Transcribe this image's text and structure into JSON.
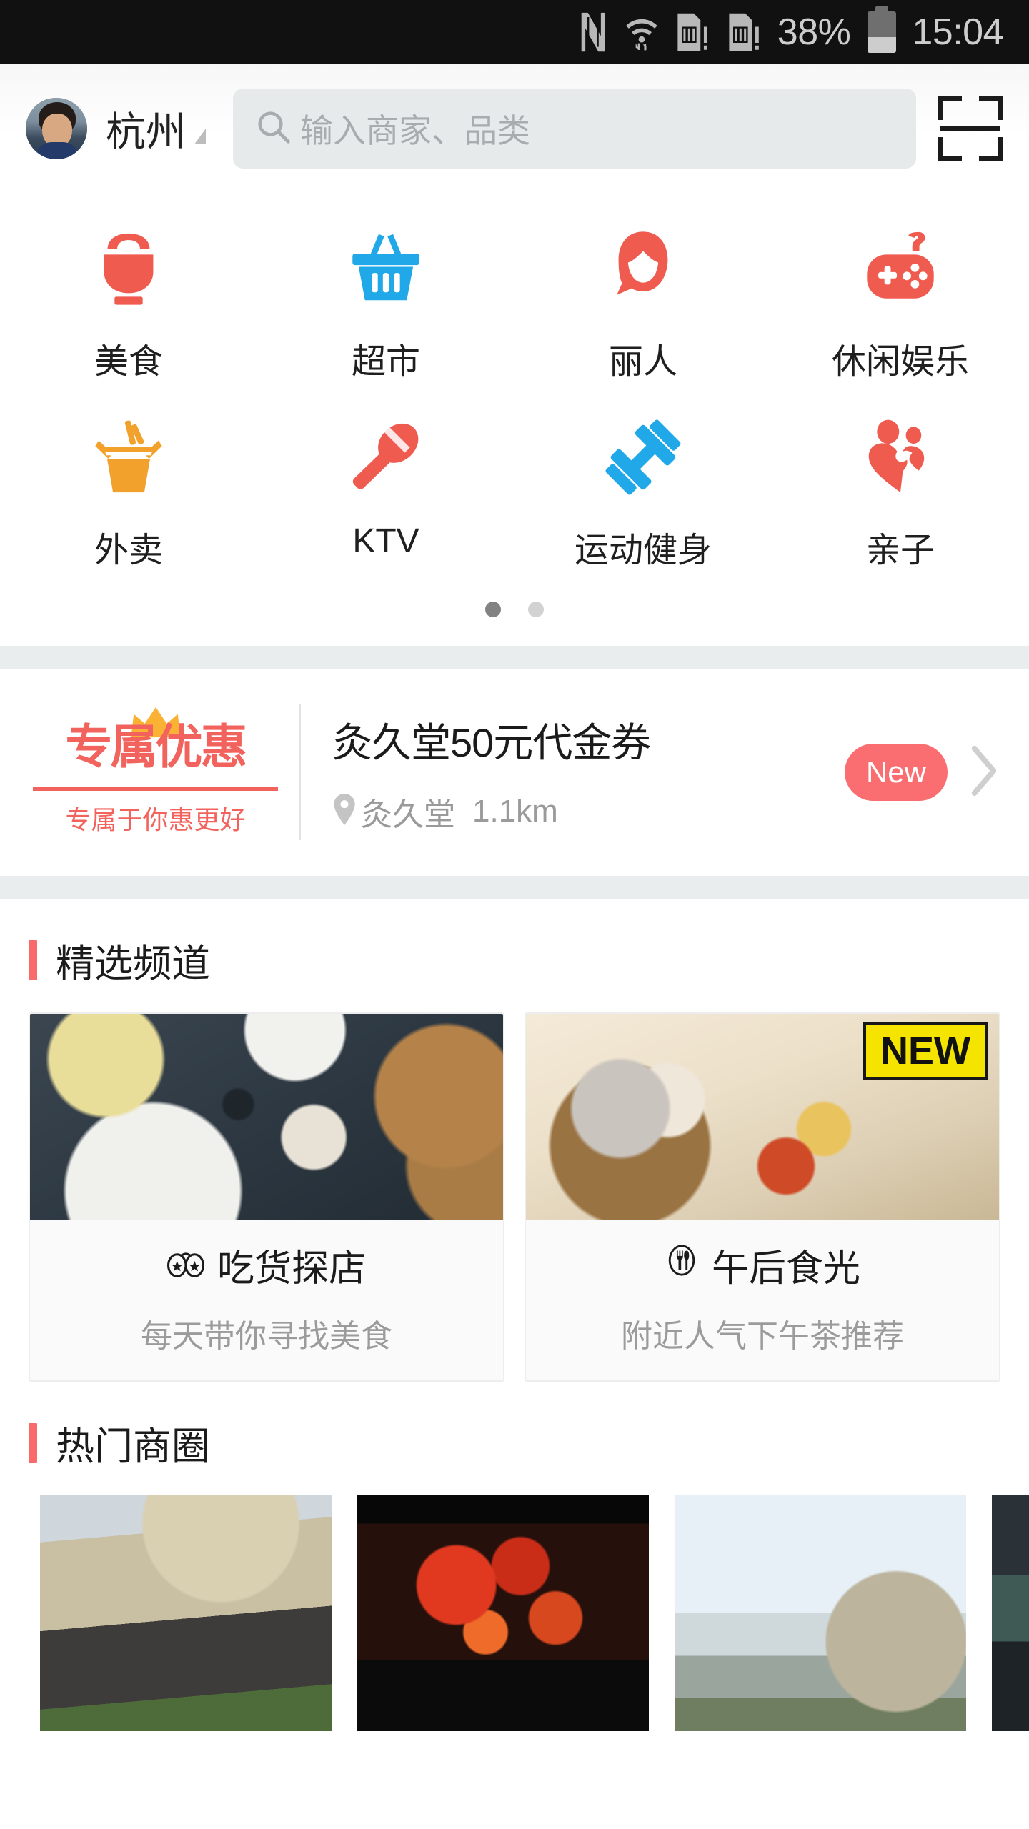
{
  "status_bar": {
    "icons": [
      "nfc-icon",
      "wifi-icon",
      "sim1-alert-icon",
      "sim2-alert-icon"
    ],
    "battery_percent": "38%",
    "time": "15:04"
  },
  "header": {
    "avatar": "user-avatar",
    "city": "杭州",
    "city_caret": "dropdown-caret",
    "search_placeholder": "输入商家、品类",
    "search_value": "",
    "scan_icon": "scan-qr-icon"
  },
  "categories": {
    "rows": [
      [
        {
          "label": "美食",
          "icon": "rice-bowl-icon",
          "color": "#f05b4f"
        },
        {
          "label": "超市",
          "icon": "shopping-basket-icon",
          "color": "#21a8e8"
        },
        {
          "label": "丽人",
          "icon": "beauty-woman-icon",
          "color": "#f05b4f"
        },
        {
          "label": "休闲娱乐",
          "icon": "game-controller-icon",
          "color": "#f05b4f"
        }
      ],
      [
        {
          "label": "外卖",
          "icon": "takeout-box-icon",
          "color": "#f2a22c"
        },
        {
          "label": "KTV",
          "icon": "microphone-icon",
          "color": "#f05b4f"
        },
        {
          "label": "运动健身",
          "icon": "dumbbell-icon",
          "color": "#21a8e8"
        },
        {
          "label": "亲子",
          "icon": "parent-child-icon",
          "color": "#f05b4f"
        }
      ]
    ],
    "pager": {
      "total": 2,
      "active": 0
    }
  },
  "promo": {
    "logo_text": "专属优惠",
    "logo_sub": "专属于你惠更好",
    "crown_icon": "crown-icon",
    "title": "灸久堂50元代金券",
    "location_icon": "location-pin-icon",
    "shop": "灸久堂",
    "distance": "1.1km",
    "badge": "New",
    "chevron": "chevron-right-icon",
    "badge_color": "#fa6d71"
  },
  "featured": {
    "section_title": "精选频道",
    "accent_color": "#fa6a6a",
    "cards": [
      {
        "icon": "binoculars-icon",
        "title": "吃货探店",
        "subtitle": "每天带你寻找美食",
        "image": "food-flatlay-photo",
        "badge": ""
      },
      {
        "icon": "fork-knife-circle-icon",
        "title": "午后食光",
        "subtitle": "附近人气下午茶推荐",
        "image": "coffee-mokapot-photo",
        "badge": "NEW",
        "badge_bg": "#f5e400"
      }
    ]
  },
  "hot_district": {
    "section_title": "热门商圈",
    "accent_color": "#fa6a6a",
    "thumbnails": [
      "mall-daytime-photo",
      "red-lantern-building-night-photo",
      "plaza-blue-sky-photo",
      "storefront-partial-photo"
    ]
  }
}
